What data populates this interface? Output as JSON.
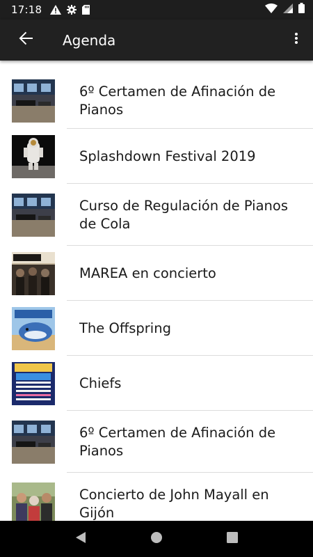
{
  "status_bar": {
    "time": "17:18",
    "left_icons": [
      "warning-icon",
      "gear-icon",
      "sd-card-icon"
    ],
    "right_icons": [
      "wifi-icon",
      "cell-signal-icon",
      "battery-icon"
    ]
  },
  "app_bar": {
    "title": "Agenda",
    "back_icon": "arrow-back-icon",
    "menu_icon": "more-vert-icon"
  },
  "events": [
    {
      "title": "6º Certamen de Afinación de Pianos",
      "thumbnail": "piano-room-photo"
    },
    {
      "title": "Splashdown Festival 2019",
      "thumbnail": "astronaut-photo"
    },
    {
      "title": "Curso de Regulación de Pianos de Cola",
      "thumbnail": "piano-room-photo"
    },
    {
      "title": "MAREA en concierto",
      "thumbnail": "band-poster"
    },
    {
      "title": "The Offspring",
      "thumbnail": "festival-whale-poster"
    },
    {
      "title": "Chiefs",
      "thumbnail": "festival-lineup-poster"
    },
    {
      "title": "6º Certamen de Afinación de Pianos",
      "thumbnail": "piano-room-photo"
    },
    {
      "title": "Concierto de John Mayall en Gijón",
      "thumbnail": "band-group-photo"
    }
  ],
  "colors": {
    "status_bar": "#1e1e1e",
    "app_bar": "#212121",
    "nav_bar": "#000000",
    "divider": "#dcdcdc",
    "text": "#1a1a1a"
  },
  "nav_bar": {
    "buttons": [
      "back-triangle-icon",
      "home-circle-icon",
      "recents-square-icon"
    ]
  }
}
